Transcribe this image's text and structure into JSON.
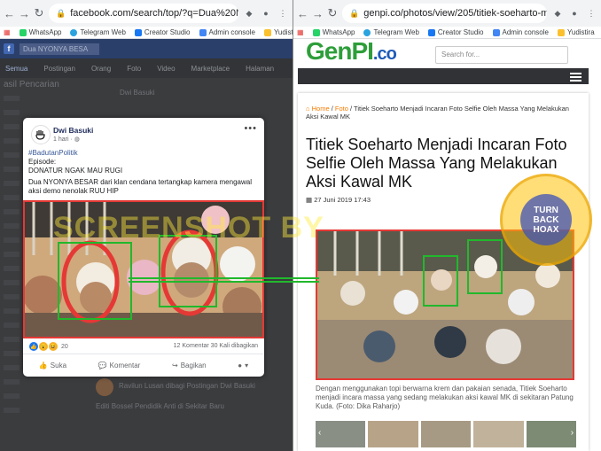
{
  "left_browser": {
    "url": "facebook.com/search/top/?q=Dua%20NYONY...",
    "bookmarks": [
      "WhatsApp",
      "Telegram Web",
      "Creator Studio",
      "Admin console",
      "Yudistira"
    ]
  },
  "right_browser": {
    "url": "genpi.co/photos/view/205/titiek-soeharto-me...",
    "bookmarks": [
      "WhatsApp",
      "Telegram Web",
      "Creator Studio",
      "Admin console",
      "Yudistira"
    ]
  },
  "fb_post": {
    "author": "Dwi Basuki",
    "time": "1 hari",
    "hashtag": "#BadutanPolitik",
    "line1": "Episode:",
    "line2": "DONATUR NGAK MAU RUGI",
    "body": "Dua NYONYA BESAR dari klan cendana tertangkap kamera mengawal aksi demo nenolak RUU HIP",
    "reaction_count": "20",
    "stats": "12 Komentar  30 Kali dibagikan",
    "like_label": "Suka",
    "comment_label": "Komentar",
    "share_label": "Bagikan"
  },
  "fb_background": {
    "search_text": "Dua NYONYA BESA",
    "tabs": [
      "Semua",
      "Postingan",
      "Orang",
      "Foto",
      "Video",
      "Marketplace",
      "Halaman"
    ],
    "side_title": "asil Pencarian",
    "ghost_author": "Dwi Basuki",
    "ghost_share": "Ravilun Lusan dibagi Postingan Dwi Basuki",
    "ghost_share_sub": "Editi Bossel Pendidik Anti di Sekitar Baru"
  },
  "site": {
    "logo_main": "GenPI",
    "logo_tld": ".co",
    "search_placeholder": "Search for...",
    "breadcrumb_home": "Home",
    "breadcrumb_foto": "Foto",
    "breadcrumb_title": "Titiek Soeharto Menjadi Incaran Foto Selfie Oleh Massa Yang Melakukan Aksi Kawal MK",
    "title": "Titiek Soeharto Menjadi Incaran Foto Selfie Oleh Massa Yang Melakukan Aksi Kawal MK",
    "date": "27 Juni 2019 17:43",
    "caption": "Dengan menggunakan topi berwarna krem dan pakaian senada, Titiek Soeharto menjadi incara massa yang sedang melakukan aksi kawal MK di sekitaran Patung Kuda. (Foto: Dika Raharjo)"
  },
  "overlay": {
    "watermark": "SCREENSHOT BY",
    "seal_line1": "TURN",
    "seal_line2": "BACK",
    "seal_line3": "HOAX"
  },
  "colors": {
    "fb_blue": "#385898",
    "genpi_green": "#2e9e3a",
    "genpi_blue": "#1e5bb8",
    "highlight_red": "#e53935",
    "connector_green": "#21b82c"
  }
}
